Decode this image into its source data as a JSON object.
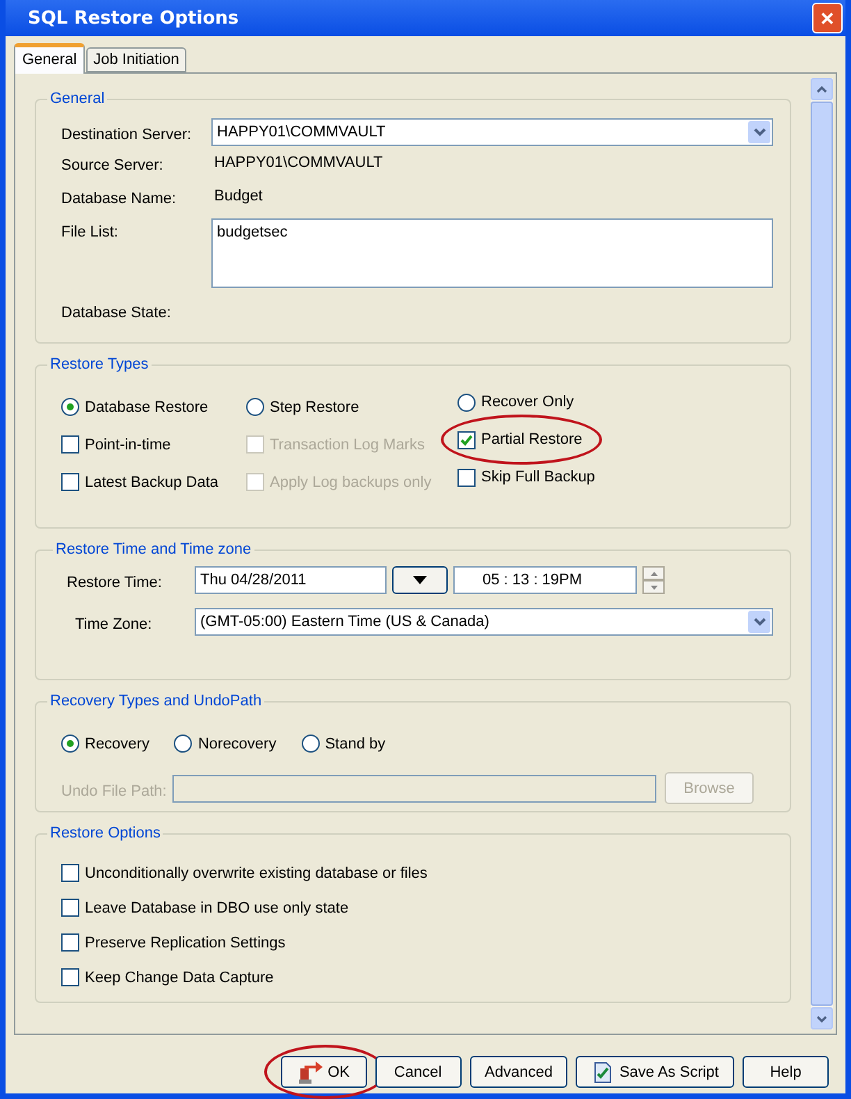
{
  "window": {
    "title": "SQL Restore Options",
    "close_icon": "✕"
  },
  "tabs": [
    {
      "label": "General",
      "selected": true
    },
    {
      "label": "Job Initiation",
      "selected": false
    }
  ],
  "general": {
    "title": "General",
    "destination_server": {
      "label": "Destination Server:",
      "value": "HAPPY01\\COMMVAULT"
    },
    "source_server": {
      "label": "Source Server:",
      "value": "HAPPY01\\COMMVAULT"
    },
    "database_name": {
      "label": "Database Name:",
      "value": "Budget"
    },
    "file_list": {
      "label": "File List:",
      "value": "budgetsec"
    },
    "database_state": {
      "label": "Database State:"
    }
  },
  "restore_types": {
    "title": "Restore Types",
    "items": [
      {
        "kind": "radio",
        "label": "Database Restore",
        "selected": true,
        "disabled": false,
        "highlighted": false
      },
      {
        "kind": "radio",
        "label": "Step Restore",
        "selected": false,
        "disabled": false,
        "highlighted": false
      },
      {
        "kind": "radio",
        "label": "Recover Only",
        "selected": false,
        "disabled": false,
        "highlighted": false
      },
      {
        "kind": "checkbox",
        "label": "Point-in-time",
        "checked": false,
        "disabled": false,
        "highlighted": false
      },
      {
        "kind": "checkbox",
        "label": "Transaction Log Marks",
        "checked": false,
        "disabled": true,
        "highlighted": false
      },
      {
        "kind": "checkbox",
        "label": "Partial Restore",
        "checked": true,
        "disabled": false,
        "highlighted": true
      },
      {
        "kind": "checkbox",
        "label": "Latest Backup Data",
        "checked": false,
        "disabled": false,
        "highlighted": false
      },
      {
        "kind": "checkbox",
        "label": "Apply Log backups only",
        "checked": false,
        "disabled": true,
        "highlighted": false
      },
      {
        "kind": "checkbox",
        "label": "Skip Full Backup",
        "checked": false,
        "disabled": false,
        "highlighted": false
      }
    ]
  },
  "restore_time": {
    "title": "Restore Time and Time zone",
    "restore_time": {
      "label": "Restore Time:",
      "date": "Thu 04/28/2011",
      "time": "05 : 13 : 19PM"
    },
    "time_zone": {
      "label": "Time Zone:",
      "value": "(GMT-05:00) Eastern Time (US & Canada)"
    }
  },
  "recovery_types": {
    "title": "Recovery Types and UndoPath",
    "options": [
      {
        "label": "Recovery",
        "selected": true
      },
      {
        "label": "Norecovery",
        "selected": false
      },
      {
        "label": "Stand by",
        "selected": false
      }
    ],
    "undo_file_path": {
      "label": "Undo File Path:",
      "disabled": true,
      "button": "Browse"
    }
  },
  "restore_options": {
    "title": "Restore Options",
    "items": [
      {
        "label": "Unconditionally overwrite existing database or files",
        "checked": false
      },
      {
        "label": "Leave Database in DBO use only state",
        "checked": false
      },
      {
        "label": "Preserve Replication Settings",
        "checked": false
      },
      {
        "label": "Keep Change Data Capture",
        "checked": false
      }
    ]
  },
  "buttons": [
    {
      "label": "OK",
      "highlighted": true
    },
    {
      "label": "Cancel",
      "highlighted": false
    },
    {
      "label": "Advanced",
      "highlighted": false
    },
    {
      "label": "Save As Script",
      "highlighted": false
    },
    {
      "label": "Help",
      "highlighted": false
    }
  ]
}
